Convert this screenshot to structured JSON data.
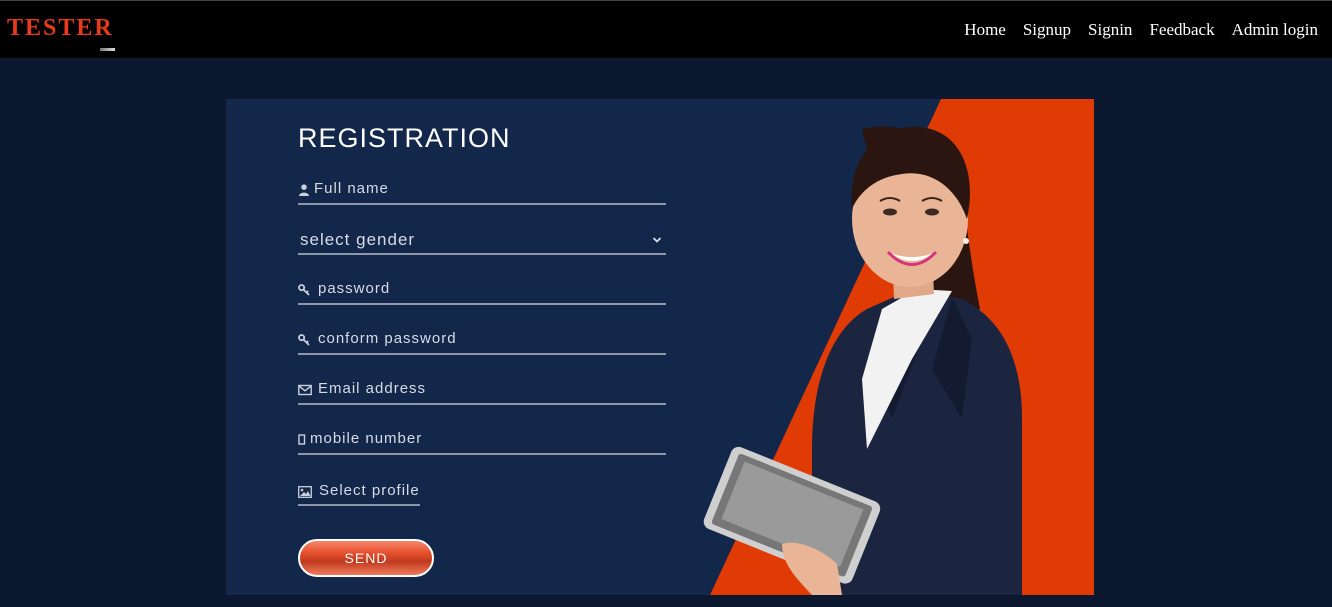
{
  "navbar": {
    "brand": "TESTER",
    "links": [
      "Home",
      "Signup",
      "Signin",
      "Feedback",
      "Admin login"
    ]
  },
  "form": {
    "title": "REGISTRATION",
    "fields": {
      "full_name": "Full name",
      "gender": "select gender",
      "password": "password",
      "confirm_password": "conform password",
      "email": "Email address",
      "mobile": "mobile number",
      "profile": "Select profile"
    },
    "submit_label": "SEND"
  },
  "colors": {
    "brand": "#e8391b",
    "accent": "#e03a05",
    "card_bg": "#13274a",
    "page_bg": "#0b1830"
  },
  "icons": [
    "user-icon",
    "chevron-down-icon",
    "key-icon",
    "key-icon",
    "envelope-icon",
    "mobile-icon",
    "image-icon"
  ]
}
